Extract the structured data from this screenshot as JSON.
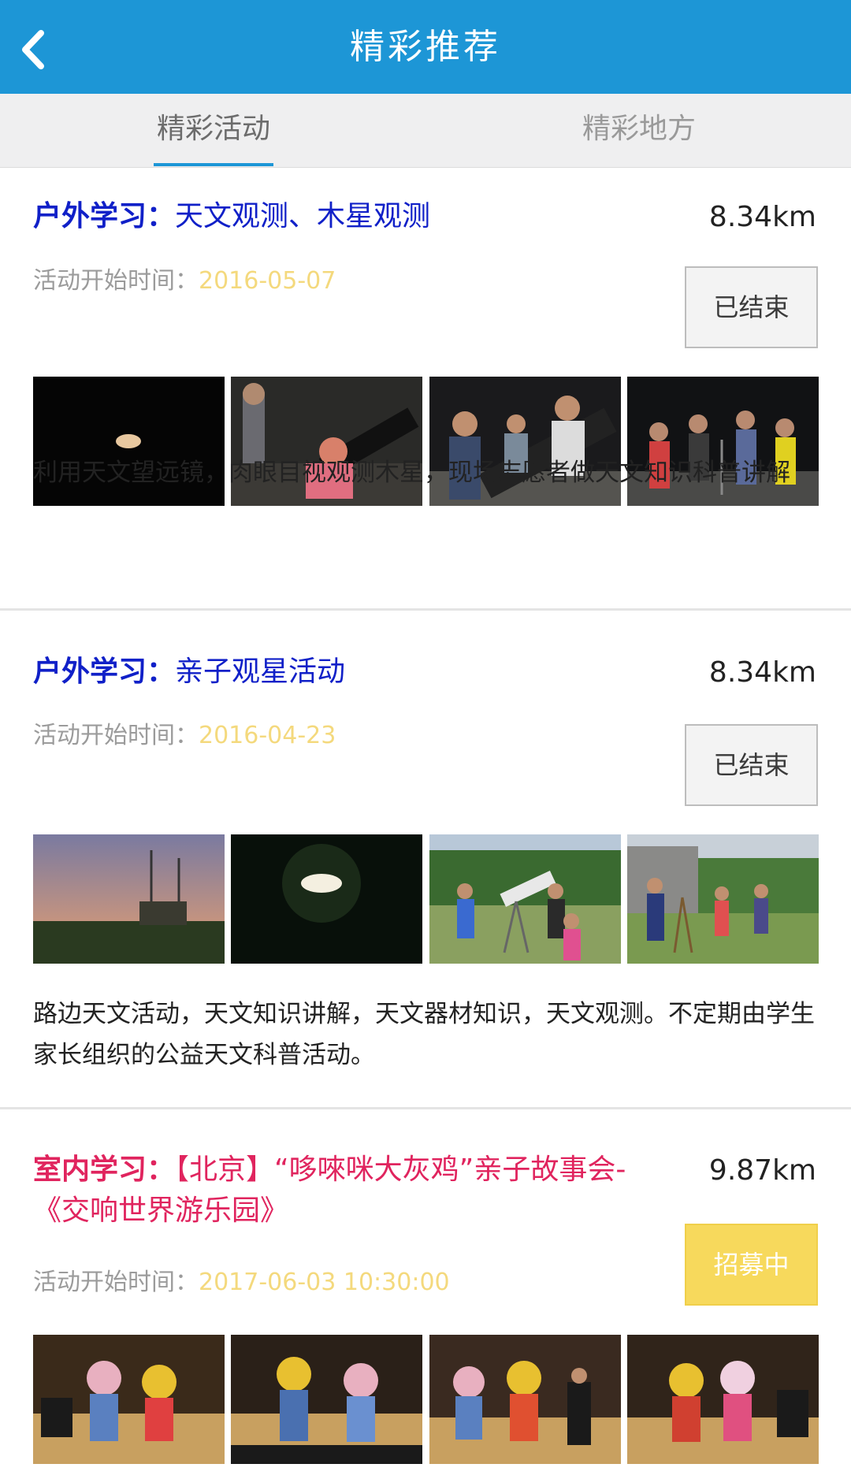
{
  "header": {
    "title": "精彩推荐",
    "back_icon": "chevron-left-icon"
  },
  "tabs": [
    {
      "label": "精彩活动",
      "active": true
    },
    {
      "label": "精彩地方",
      "active": false
    }
  ],
  "activities": [
    {
      "category": "户外学习：",
      "title": "天文观测、木星观测",
      "distance": "8.34km",
      "time_label": "活动开始时间：",
      "date": "2016-05-07",
      "status": "已结束",
      "photos": [
        "jupiter-photo",
        "telescope-night-photo",
        "crowd-telescope-photo",
        "crowd-night-photo"
      ],
      "description": "利用天文望远镜，肉眼目视观测木星，现场志愿者做天文知识科普讲解"
    },
    {
      "category": "户外学习：",
      "title": "亲子观星活动",
      "distance": "8.34km",
      "time_label": "活动开始时间：",
      "date": "2016-04-23",
      "status": "已结束",
      "photos": [
        "sunset-photo",
        "moon-photo",
        "kids-telescope-photo",
        "group-field-photo"
      ],
      "description": "路边天文活动，天文知识讲解，天文器材知识，天文观测。不定期由学生家长组织的公益天文科普活动。"
    },
    {
      "category": "室内学习：",
      "title": "【北京】“哆唻咪大灰鸡”亲子故事会-《交响世界游乐园》",
      "distance": "9.87km",
      "time_label": "活动开始时间：",
      "date": "2017-06-03 10:30:00",
      "status": "招募中",
      "photos": [
        "stage-photo-1",
        "stage-photo-2",
        "stage-photo-3",
        "stage-photo-4"
      ],
      "description": ""
    }
  ],
  "colors": {
    "header_bg": "#1d96d6",
    "outdoor_title": "#1020c8",
    "indoor_title": "#e0245e",
    "date": "#f4d97d",
    "recruiting": "#f7d95c"
  }
}
